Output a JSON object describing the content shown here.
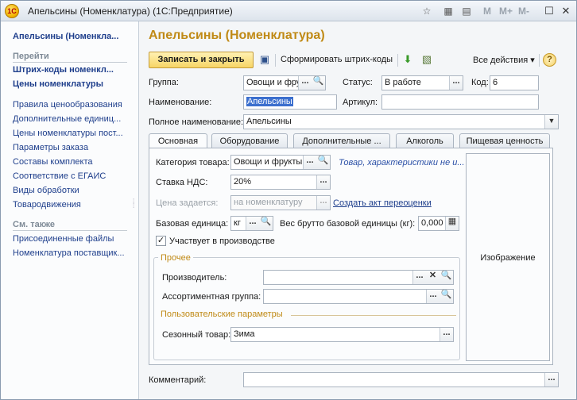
{
  "window": {
    "title": "Апельсины (Номенклатура)  (1С:Предприятие)",
    "logo_text": "1С",
    "memory_buttons": [
      "M",
      "M+",
      "M-"
    ]
  },
  "nav": {
    "title": "Апельсины (Номенкла...",
    "goto_header": "Перейти",
    "goto_bold": [
      "Штрих-коды номенкл...",
      "Цены номенклатуры"
    ],
    "goto_links": [
      "Правила ценообразования",
      "Дополнительные единиц...",
      "Цены номенклатуры пост...",
      "Параметры заказа",
      "Составы комплекта",
      "Соответствие с ЕГАИС",
      "Виды обработки",
      "Товародвижения"
    ],
    "see_also_header": "См. также",
    "see_also_links": [
      "Присоединенные файлы",
      "Номенклатура поставщик..."
    ]
  },
  "form": {
    "title": "Апельсины (Номенклатура)",
    "toolbar": {
      "write_close": "Записать и закрыть",
      "barcodes": "Сформировать штрих-коды",
      "all_actions": "Все действия ▾",
      "help": "?"
    },
    "group": {
      "label": "Группа:",
      "value": "Овощи и фрукты"
    },
    "status": {
      "label": "Статус:",
      "value": "В работе"
    },
    "code": {
      "label": "Код:",
      "value": "6"
    },
    "name": {
      "label": "Наименование:",
      "value": "Апельсины"
    },
    "article": {
      "label": "Артикул:",
      "value": ""
    },
    "full_name": {
      "label": "Полное наименование:",
      "value": "Апельсины"
    },
    "tabs": [
      "Основная",
      "Оборудование",
      "Дополнительные ...",
      "Алкоголь",
      "Пищевая ценность"
    ],
    "main_tab": {
      "category": {
        "label": "Категория товара:",
        "value": "Овощи и фрукты",
        "link": "Товар, характеристики не и..."
      },
      "vat": {
        "label": "Ставка НДС:",
        "value": "20%"
      },
      "price_set": {
        "label": "Цена задается:",
        "placeholder": "на номенклатуру",
        "link": "Создать акт переоценки"
      },
      "base_unit": {
        "label": "Базовая единица:",
        "value": "кг"
      },
      "gross_weight": {
        "label": "Вес брутто базовой единицы (кг):",
        "value": "0,000"
      },
      "production": {
        "label": "Участвует в производстве",
        "checked": true
      },
      "other_group": {
        "title": "Прочее",
        "manufacturer": {
          "label": "Производитель:",
          "value": ""
        },
        "assortment_group": {
          "label": "Ассортиментная группа:",
          "value": ""
        },
        "user_params_title": "Пользовательские параметры",
        "seasonal": {
          "label": "Сезонный товар:",
          "value": "Зима"
        }
      },
      "image_label": "Изображение"
    },
    "comment": {
      "label": "Комментарий:",
      "value": ""
    }
  },
  "colors": {
    "form_title": "#c08a16",
    "link": "#1f3f8c",
    "primary_button": "#f7d566"
  }
}
